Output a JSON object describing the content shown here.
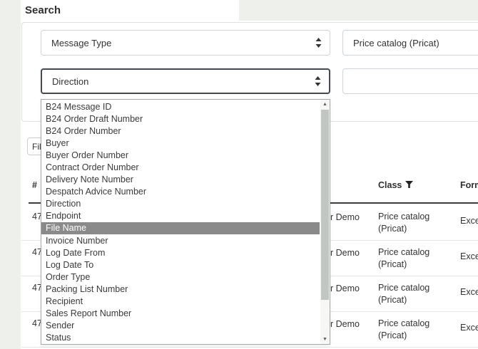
{
  "page": {
    "heading": "Search"
  },
  "search_panel": {
    "message_type_select": {
      "value": "Message Type"
    },
    "class_select": {
      "value": "Price catalog (Pricat)"
    },
    "search_field_select": {
      "value": "Direction"
    },
    "query_input": {
      "value": "",
      "placeholder": ""
    }
  },
  "filter_button": {
    "label": "Filter"
  },
  "search_field_dropdown": {
    "highlighted_option": "File Name",
    "options": [
      "B24 Message ID",
      "B24 Order Draft Number",
      "B24 Order Number",
      "Buyer",
      "Buyer Order Number",
      "Contract Order Number",
      "Delivery Note Number",
      "Despatch Advice Number",
      "Direction",
      "Endpoint",
      "File Name",
      "Invoice Number",
      "Log Date From",
      "Log Date To",
      "Order Type",
      "Packing List Number",
      "Recipient",
      "Sales Report Number",
      "Sender",
      "Status"
    ]
  },
  "results_table": {
    "columns": {
      "id": "#",
      "class": "Class",
      "format": "Format"
    },
    "rows": [
      {
        "id": "47",
        "endpoint": "ur Demo",
        "class": "Price catalog (Pricat)",
        "format": "Excel"
      },
      {
        "id": "47",
        "endpoint": "ur Demo",
        "class": "Price catalog (Pricat)",
        "format": "Excel"
      },
      {
        "id": "47",
        "endpoint": "ur Demo",
        "class": "Price catalog (Pricat)",
        "format": "Excel"
      },
      {
        "id": "47",
        "endpoint": "ur Demo",
        "class": "Price catalog (Pricat)",
        "format": "Excel"
      }
    ]
  },
  "colors": {
    "highlight_gray": "#8a8a8a",
    "focus_border": "#43494f",
    "page_gutter": "#eef0ec"
  }
}
